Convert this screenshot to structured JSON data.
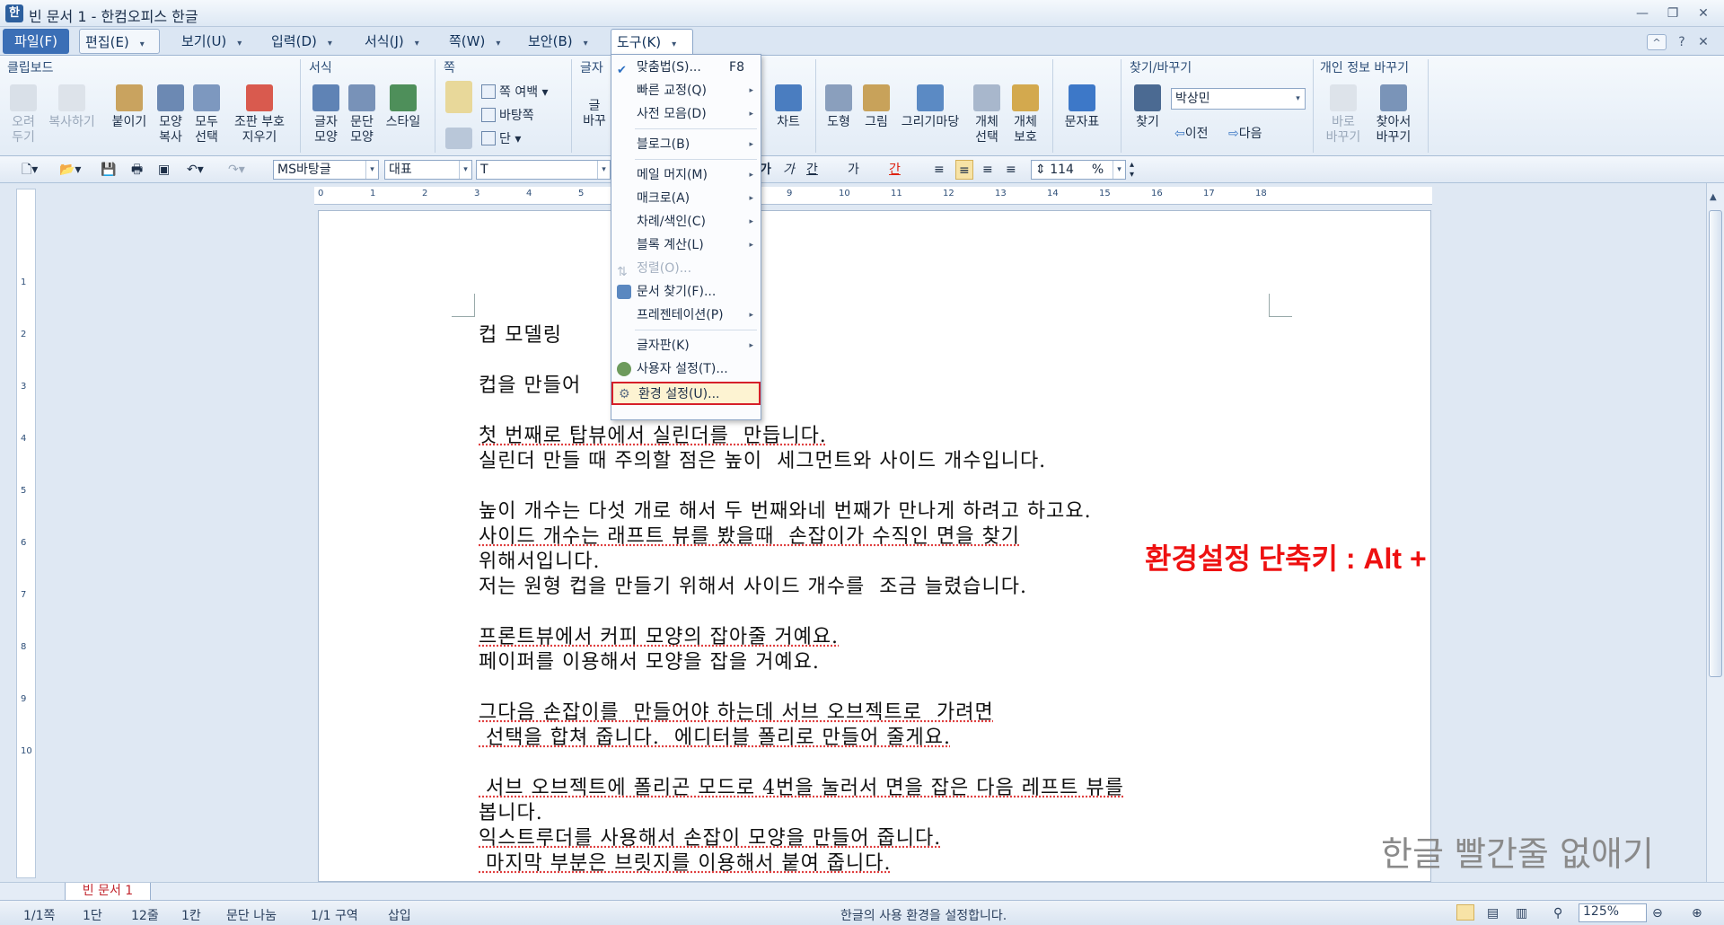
{
  "window": {
    "title": "빈 문서 1 - 한컴오피스 한글",
    "app_icon": "한",
    "min": "—",
    "restore": "❐",
    "close": "✕",
    "help": "?",
    "ribbon_toggle": "^"
  },
  "menus": [
    {
      "label": "파일(F)"
    },
    {
      "label": "편집(E)"
    },
    {
      "label": "보기(U)"
    },
    {
      "label": "입력(D)"
    },
    {
      "label": "서식(J)"
    },
    {
      "label": "쪽(W)"
    },
    {
      "label": "보안(B)"
    },
    {
      "label": "도구(K)"
    }
  ],
  "ribbon": {
    "groups": {
      "clipboard": "클립보드",
      "format": "서식",
      "page": "쪽",
      "char": "글자",
      "find": "찾기/바꾸기",
      "privacy": "개인 정보 바꾸기"
    },
    "cut": "오려\n두기",
    "copy": "복사하기",
    "paste": "붙이기",
    "format_copy": "모양\n복사",
    "select_all": "모두\n선택",
    "clear_format": "조판 부호\n지우기",
    "char_shape": "글자\n모양",
    "para_shape": "문단\n모양",
    "style": "스타일",
    "page_margin": "쪽 여백",
    "background": "바탕쪽",
    "column": "단",
    "char_partial": "글\n바꾸",
    "chart": "차트",
    "shape": "도형",
    "picture": "그림",
    "drawing": "그리기마당",
    "obj_select": "개체\n선택",
    "obj_protect": "개체\n보호",
    "symbol": "문자표",
    "find": "찾기",
    "find_value": "박상민",
    "prev": "이전",
    "next": "다음",
    "replace_now": "바로\n바꾸기",
    "find_replace": "찾아서\n바꾸기"
  },
  "toolbar": {
    "font_lang": "MS바탕글",
    "style": "대표",
    "font": "T",
    "zoom_percent": "114",
    "percent_sign": "%",
    "char_buttons": [
      "가",
      "가",
      "간",
      "가",
      "간"
    ]
  },
  "tools_menu": [
    {
      "label": "맞춤법(S)...",
      "shortcut": "F8",
      "submenu": false,
      "disabled": false
    },
    {
      "label": "빠른 교정(Q)",
      "submenu": true,
      "disabled": false
    },
    {
      "label": "사전 모음(D)",
      "submenu": true,
      "disabled": false
    },
    {
      "label": "블로그(B)",
      "submenu": true,
      "disabled": false
    },
    {
      "label": "메일 머지(M)",
      "submenu": true,
      "disabled": false
    },
    {
      "label": "매크로(A)",
      "submenu": true,
      "disabled": false
    },
    {
      "label": "차례/색인(C)",
      "submenu": true,
      "disabled": false
    },
    {
      "label": "블록 계산(L)",
      "submenu": true,
      "disabled": false
    },
    {
      "label": "정렬(O)...",
      "submenu": false,
      "disabled": true
    },
    {
      "label": "문서 찾기(F)...",
      "submenu": false,
      "disabled": false
    },
    {
      "label": "프레젠테이션(P)",
      "submenu": true,
      "disabled": false
    },
    {
      "label": "글자판(K)",
      "submenu": true,
      "disabled": false
    },
    {
      "label": "사용자 설정(T)...",
      "submenu": false,
      "disabled": false
    },
    {
      "label": "환경 설정(U)...",
      "submenu": false,
      "disabled": false
    }
  ],
  "document": {
    "lines": [
      "컵 모델링",
      "",
      "컵을 만들어",
      "",
      "첫 번째로 탑뷰에서 실린더를  만듭니다.",
      "실린더 만들 때 주의할 점은 높이  세그먼트와 사이드 개수입니다.",
      "",
      "높이 개수는 다섯 개로 해서 두 번째와네 번째가 만나게 하려고 하고요.",
      "사이드 개수는 래프트 뷰를 봤을때  손잡이가 수직인 면을 찾기",
      "위해서입니다.",
      "저는 원형 컵을 만들기 위해서 사이드 개수를  조금 늘렸습니다.",
      "",
      "프론트뷰에서 커피 모양의 잡아줄 거예요.",
      "페이퍼를 이용해서 모양을 잡을 거예요.",
      "",
      "그다음 손잡이를  만들어야 하는데 서브 오브젝트로  가려면",
      " 선택을 합쳐 줍니다.  에디터블 폴리로 만들어 줄게요.",
      "",
      " 서브 오브젝트에 폴리곤 모드로 4번을 눌러서 면을 잡은 다음 레프트 뷰를",
      "봅니다.",
      "익스트루더를 사용해서 손잡이 모양을 만들어 줍니다.",
      " 마지막 부분은 브릿지를 이용해서 붙여 줍니다."
    ],
    "annotation": "환경설정 단축키 : Alt + K   ->   U",
    "watermark": "한글 빨간줄 없애기"
  },
  "tabs": {
    "doc_tab": "빈 문서 1"
  },
  "status": {
    "page": "1/1쪽",
    "column": "1단",
    "line": "12줄",
    "col": "1칸",
    "para_break": "문단 나눔",
    "section": "1/1 구역",
    "mode": "삽입",
    "message": "한글의 사용 환경을 설정합니다.",
    "zoom": "125%"
  },
  "colors": {
    "accent": "#3b6fb6",
    "highlight_border": "#d61f2a",
    "annotation": "#e11111"
  }
}
